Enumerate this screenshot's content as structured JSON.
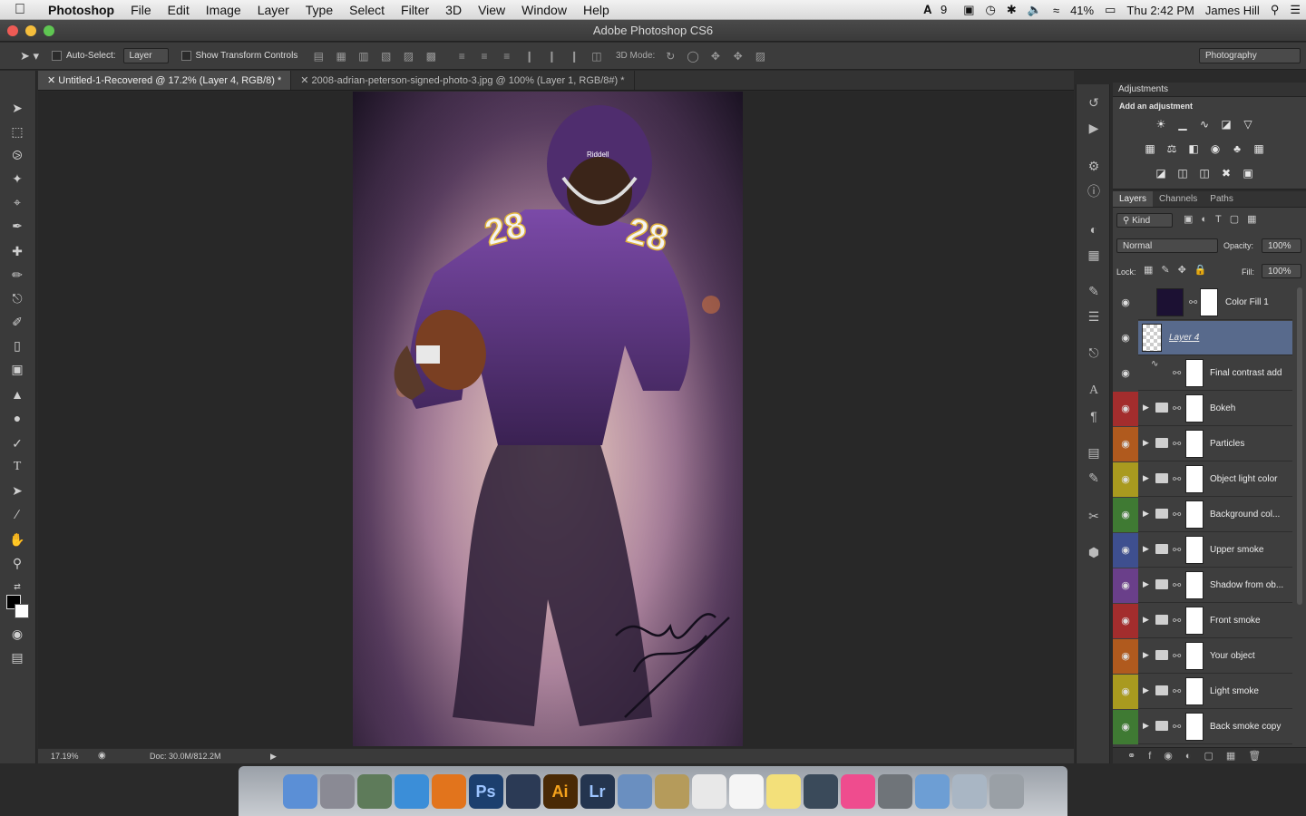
{
  "menubar": {
    "app_name": "Photoshop",
    "menus": [
      "File",
      "Edit",
      "Image",
      "Layer",
      "Type",
      "Select",
      "Filter",
      "3D",
      "View",
      "Window",
      "Help"
    ],
    "status": {
      "adobe_badge": "9",
      "battery": "41%",
      "clock": "Thu 2:42 PM",
      "user": "James Hill"
    }
  },
  "window": {
    "title": "Adobe Photoshop CS6"
  },
  "options_bar": {
    "auto_select_label": "Auto-Select:",
    "auto_select_value": "Layer",
    "transform_label": "Show Transform Controls",
    "mode_label": "3D Mode:",
    "workspace": "Photography"
  },
  "doc_tabs": [
    {
      "label": "Untitled-1-Recovered @ 17.2% (Layer 4, RGB/8) *"
    },
    {
      "label": "2008-adrian-peterson-signed-photo-3.jpg @ 100% (Layer 1, RGB/8#) *"
    }
  ],
  "statusbar": {
    "zoom": "17.19%",
    "doc": "Doc: 30.0M/812.2M"
  },
  "adjustments": {
    "tab": "Adjustments",
    "subtitle": "Add an adjustment"
  },
  "layers_panel": {
    "tabs": [
      "Layers",
      "Channels",
      "Paths"
    ],
    "kind": "Kind",
    "blend_mode": "Normal",
    "opacity_label": "Opacity:",
    "opacity": "100%",
    "lock_label": "Lock:",
    "fill_label": "Fill:",
    "fill": "100%",
    "layers": [
      {
        "name": "Color Fill 1",
        "color": "#3e3e3e"
      },
      {
        "name": "Layer 4",
        "color": "#3e3e3e"
      },
      {
        "name": "Final contrast add",
        "color": "#3e3e3e"
      },
      {
        "name": "Bokeh",
        "color": "#a32d2d"
      },
      {
        "name": "Particles",
        "color": "#b05a1e"
      },
      {
        "name": "Object light color",
        "color": "#a99a1f"
      },
      {
        "name": "Background col...",
        "color": "#3f7a33"
      },
      {
        "name": "Upper smoke",
        "color": "#3e4f8f"
      },
      {
        "name": "Shadow from ob...",
        "color": "#6a3f8a"
      },
      {
        "name": "Front smoke",
        "color": "#a32d2d"
      },
      {
        "name": "Your object",
        "color": "#b05a1e"
      },
      {
        "name": "Light smoke",
        "color": "#a99a1f"
      },
      {
        "name": "Back smoke copy",
        "color": "#3f7a33"
      }
    ]
  },
  "artwork": {
    "jersey_number": "28",
    "helmet_text": "Riddell"
  },
  "dock": [
    "Finder",
    "Launchpad",
    "Preview",
    "Safari",
    "Firefox",
    "Ps",
    "Cinema",
    "Ai",
    "Lr",
    "Mail",
    "Contacts",
    "Calendar",
    "Reminders",
    "Notes",
    "FaceTime",
    "iTunes",
    "System Preferences",
    "Downloads",
    "Documents",
    "Trash"
  ]
}
